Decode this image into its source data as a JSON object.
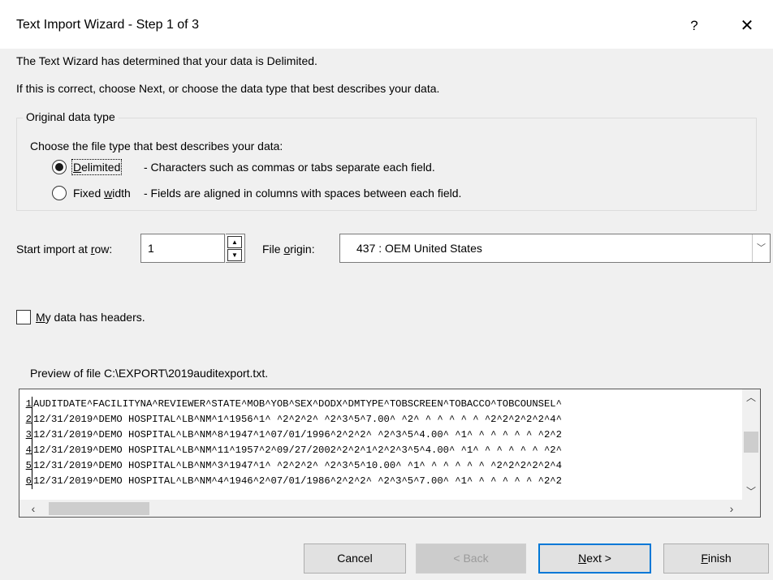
{
  "window": {
    "title": "Text Import Wizard - Step 1 of 3",
    "help_glyph": "?",
    "close_glyph": "✕"
  },
  "intro": {
    "line1": "The Text Wizard has determined that your data is Delimited.",
    "line2": "If this is correct, choose Next, or choose the data type that best describes your data."
  },
  "data_type_group": {
    "legend": "Original data type",
    "prompt": "Choose the file type that best describes your data:",
    "options": [
      {
        "label": "Delimited",
        "mnemonic": "D",
        "description": "- Characters such as commas or tabs separate each field.",
        "checked": true
      },
      {
        "label": "Fixed width",
        "mnemonic": "w",
        "description": "- Fields are aligned in columns with spaces between each field.",
        "checked": false
      }
    ]
  },
  "start_row": {
    "label": "Start import at row:",
    "value": "1"
  },
  "file_origin": {
    "label": "File origin:",
    "value": "437 : OEM United States"
  },
  "headers_checkbox": {
    "label": "My data has headers.",
    "checked": false
  },
  "preview": {
    "label": "Preview of file C:\\EXPORT\\2019auditexport.txt.",
    "lines": [
      {
        "num": "1",
        "text": "AUDITDATE^FACILITYNA^REVIEWER^STATE^MOB^YOB^SEX^DODX^DMTYPE^TOBSCREEN^TOBACCO^TOBCOUNSEL^"
      },
      {
        "num": "2",
        "text": "12/31/2019^DEMO HOSPITAL^LB^NM^1^1956^1^ ^2^2^2^ ^2^3^5^7.00^ ^2^ ^ ^ ^ ^ ^ ^2^2^2^2^2^4^"
      },
      {
        "num": "3",
        "text": "12/31/2019^DEMO HOSPITAL^LB^NM^8^1947^1^07/01/1996^2^2^2^ ^2^3^5^4.00^ ^1^ ^ ^ ^ ^ ^ ^2^2"
      },
      {
        "num": "4",
        "text": "12/31/2019^DEMO HOSPITAL^LB^NM^11^1957^2^09/27/2002^2^2^1^2^2^3^5^4.00^ ^1^ ^ ^ ^ ^ ^ ^2^"
      },
      {
        "num": "5",
        "text": "12/31/2019^DEMO HOSPITAL^LB^NM^3^1947^1^ ^2^2^2^ ^2^3^5^10.00^ ^1^ ^ ^ ^ ^ ^ ^2^2^2^2^2^4"
      },
      {
        "num": "6",
        "text": "12/31/2019^DEMO HOSPITAL^LB^NM^4^1946^2^07/01/1986^2^2^2^ ^2^3^5^7.00^ ^1^ ^ ^ ^ ^ ^ ^2^2"
      }
    ]
  },
  "buttons": {
    "cancel": "Cancel",
    "back": "< Back",
    "next": "Next >",
    "finish": "Finish"
  }
}
